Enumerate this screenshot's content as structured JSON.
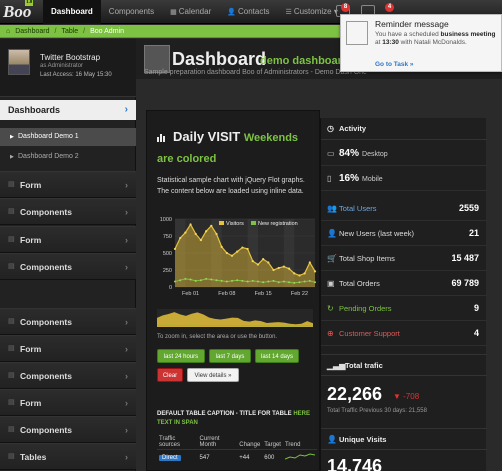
{
  "app": {
    "logo": "Boo",
    "version": "1.0"
  },
  "nav": {
    "items": [
      {
        "label": "Dashboard",
        "icon": ""
      },
      {
        "label": "Components",
        "icon": ""
      },
      {
        "label": "Calendar",
        "icon": "calendar-icon"
      },
      {
        "label": "Contacts",
        "icon": "contacts-icon"
      },
      {
        "label": "Customize",
        "icon": "customize-icon"
      }
    ],
    "badges": [
      "8",
      "4"
    ]
  },
  "breadcrumb": [
    "Dashboard",
    "Table",
    "Boo Admin"
  ],
  "profile": {
    "name": "Twitter Bootstrap",
    "role": "as Administrator",
    "last_access": "Last Access: 16 May 15:30"
  },
  "sidebar": {
    "dashboards": "Dashboards",
    "subitems": [
      "Dashboard Demo 1",
      "Dashboard Demo 2"
    ],
    "menu": [
      "Form",
      "Components",
      "Form",
      "Components",
      "Components",
      "Form",
      "Components",
      "Form",
      "Components",
      "Tables"
    ]
  },
  "header": {
    "title": "Dashboard",
    "subtitle": "demo dashboard",
    "description": "Sample preparation dashboard Boo of Administrators - Demo Dash One"
  },
  "daily": {
    "title": "Daily VISIT",
    "title_green": "Weekends are colored",
    "text": "Statistical sample chart with jQuery Flot graphs. The content below are loaded using inline data.",
    "zoom_hint": "To zoom in, select the area or use the button."
  },
  "chart_data": {
    "type": "line",
    "series": [
      {
        "name": "Visitors",
        "values": [
          560,
          720,
          800,
          920,
          780,
          690,
          820,
          900,
          780,
          590,
          500,
          460,
          520,
          580,
          560,
          380,
          330,
          410,
          360,
          250,
          280,
          300,
          270,
          200,
          170,
          200,
          360,
          230
        ]
      },
      {
        "name": "New registration",
        "values": [
          80,
          100,
          120,
          110,
          90,
          100,
          120,
          110,
          100,
          90,
          80,
          90,
          100,
          90,
          80,
          90,
          80,
          70,
          80,
          90,
          70,
          80,
          70,
          60,
          70,
          80,
          90,
          70
        ]
      }
    ],
    "x_ticks": [
      "Feb 01",
      "Feb 08",
      "Feb 15",
      "Feb 22"
    ],
    "y_ticks": [
      "1000",
      "750",
      "500",
      "250",
      "0"
    ],
    "ylim": [
      0,
      1000
    ],
    "legend": "top-center",
    "grid": true
  },
  "buttons": {
    "last24": "last 24 hours",
    "last7": "last 7 days",
    "last14": "last 14 days",
    "clear": "Clear",
    "details": "View details »"
  },
  "table": {
    "caption": "DEFAULT TABLE CAPTION - TITLE FOR TABLE",
    "caption_green": "HERE TEXT IN SPAN",
    "headers": [
      "Traffic sources",
      "Current Month",
      "Change",
      "Target",
      "Trend"
    ],
    "row": [
      "Direct",
      "547",
      "+44",
      "600",
      ""
    ]
  },
  "activity": {
    "title": "Activity",
    "desktop_pct": "84%",
    "desktop_label": "Desktop",
    "mobile_pct": "16%",
    "mobile_label": "Mobile",
    "rows": [
      {
        "label": "Total Users",
        "value": "2559"
      },
      {
        "label": "New Users (last week)",
        "value": "21"
      },
      {
        "label": "Total Shop Items",
        "value": "15 487"
      },
      {
        "label": "Total Orders",
        "value": "69 789"
      },
      {
        "label": "Pending Orders",
        "value": "9"
      },
      {
        "label": "Customer Support",
        "value": "4"
      }
    ]
  },
  "traffic": {
    "title": "Total trafic",
    "value": "22,266",
    "delta": "-708",
    "sub": "Total Traffic Previous 30 days: 21,558"
  },
  "unique": {
    "title": "Unique Visits",
    "value": "14,746"
  },
  "notification": {
    "title": "Reminder message",
    "text_pre": "You have a scheduled",
    "text_bold": "business meeting",
    "text_at": "at",
    "time": "13:30",
    "text_post": "with Natali McDonalds.",
    "link": "Go to Task »"
  },
  "colors": {
    "accent_green": "#7dc242",
    "blue": "#2a78c8",
    "red": "#cc3333",
    "chart_yellow": "#e8c23a"
  }
}
